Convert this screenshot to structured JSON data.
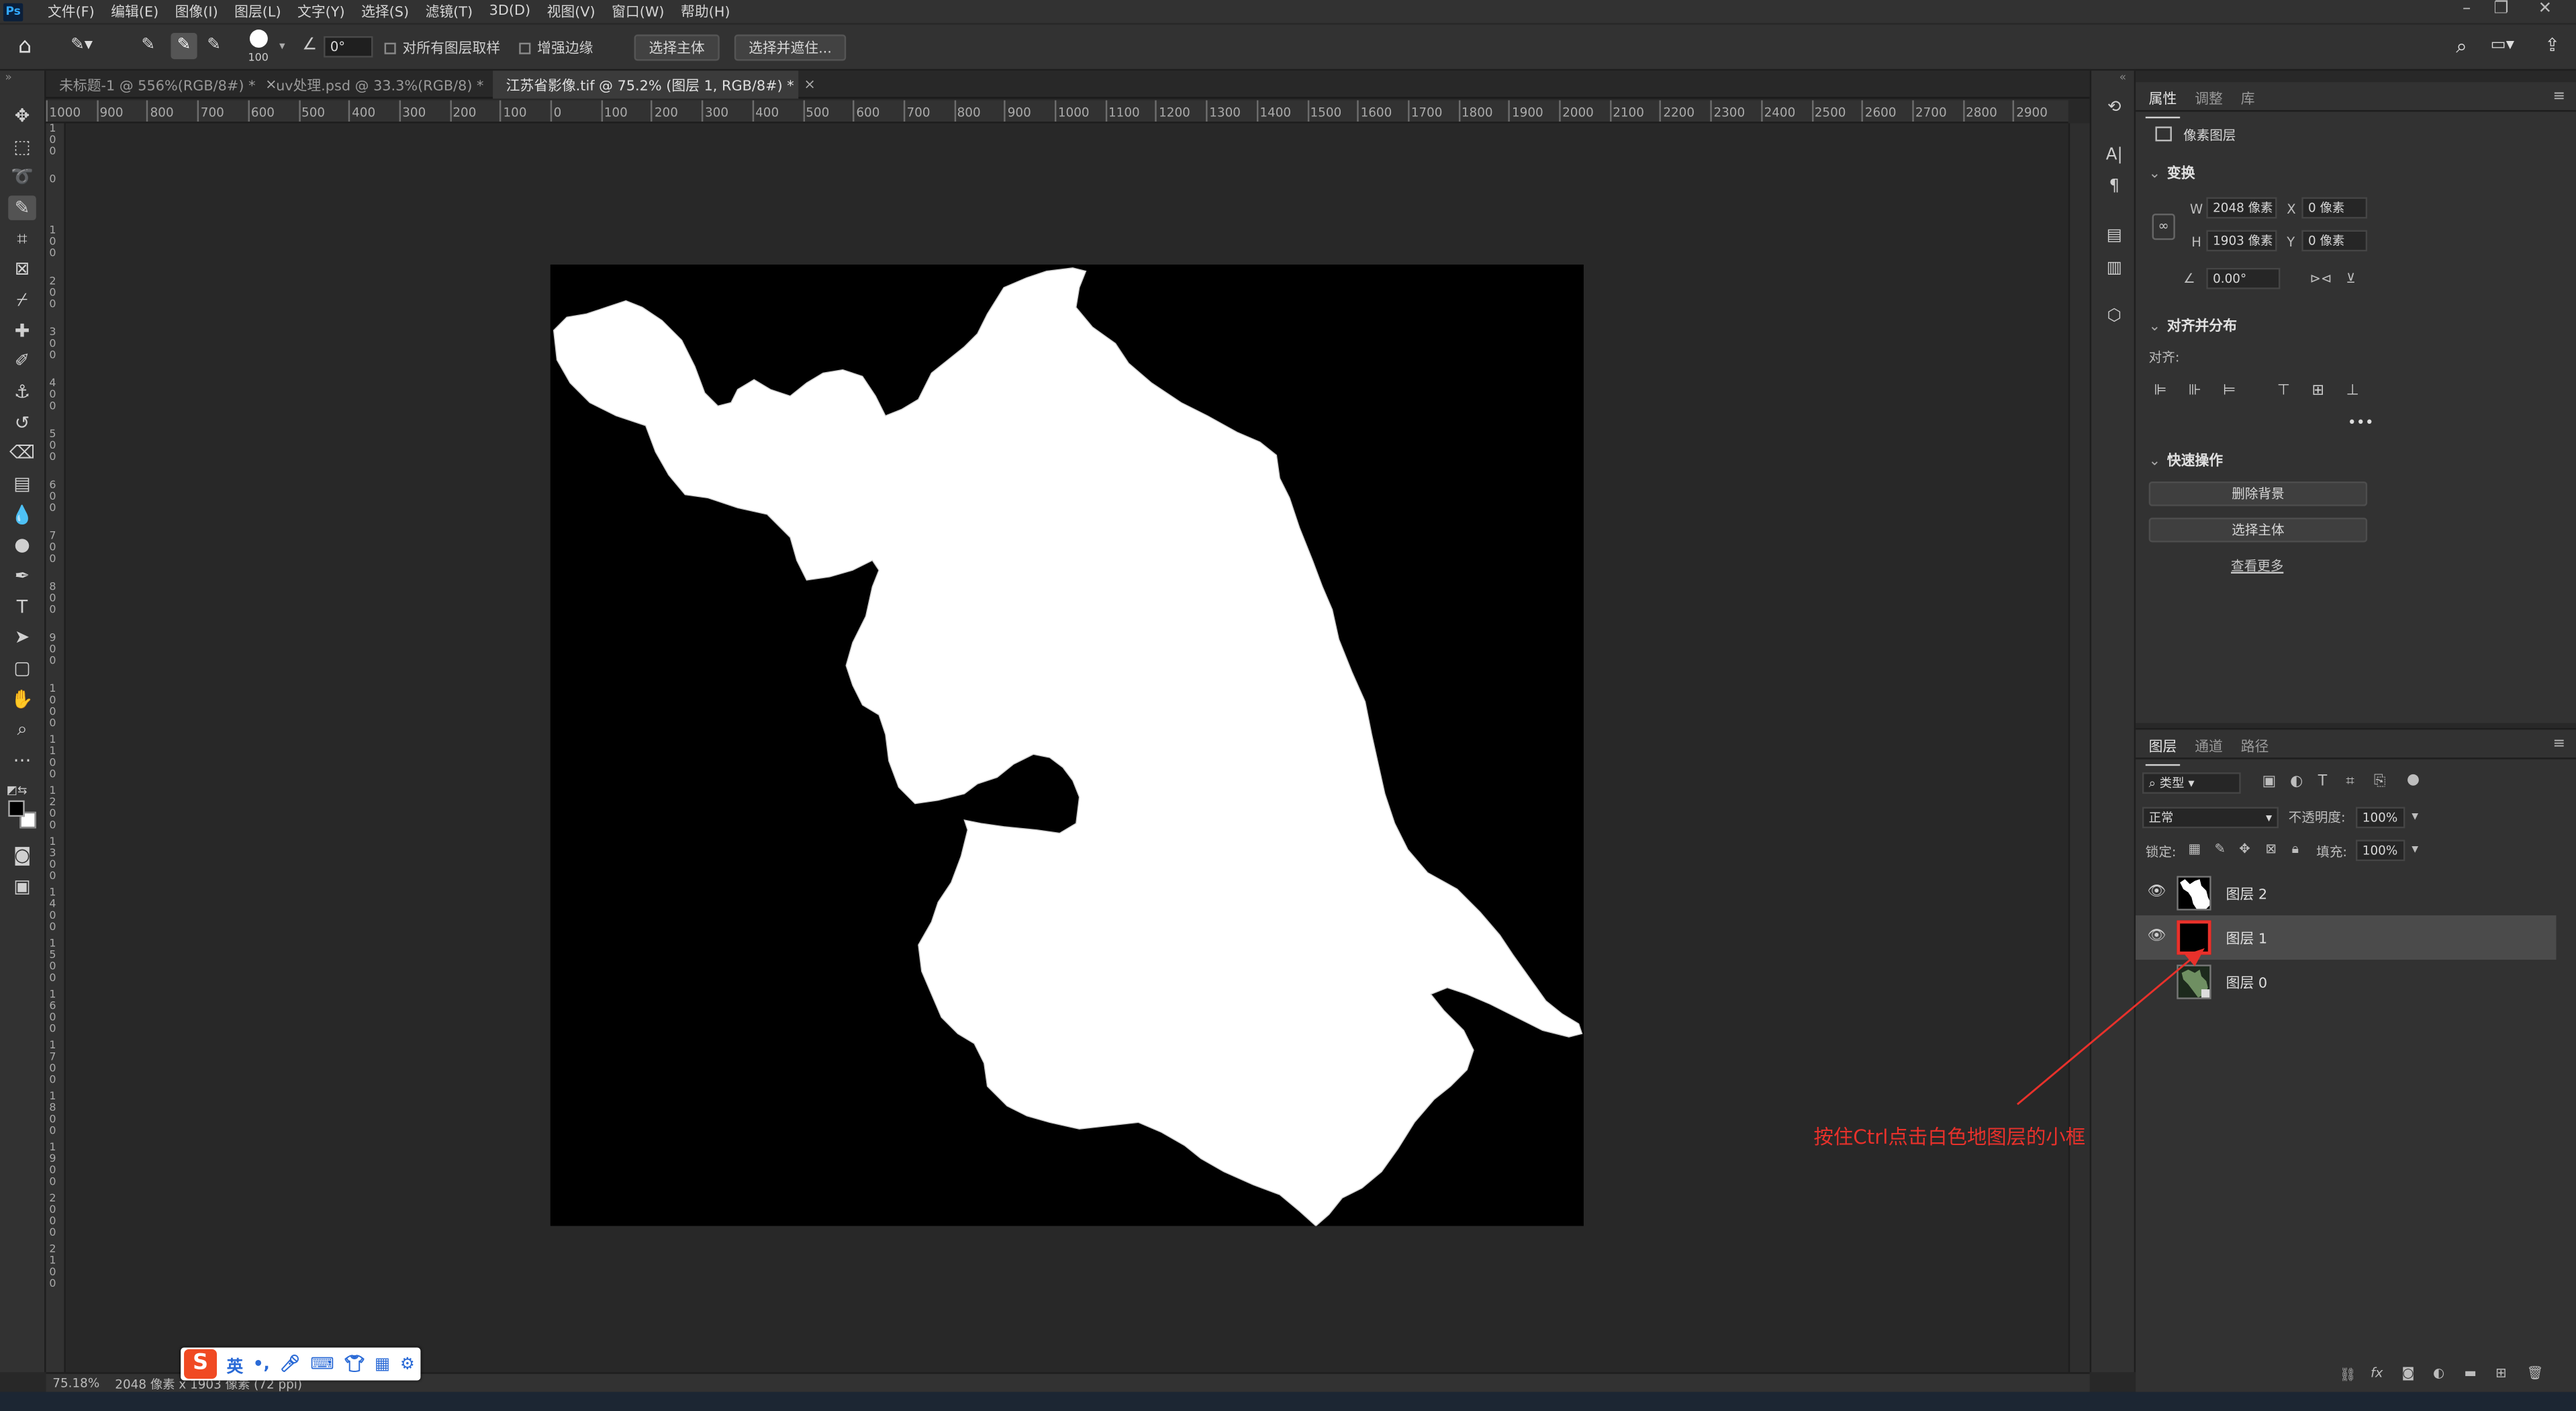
{
  "menu": {
    "logo": "Ps",
    "items": [
      "文件(F)",
      "编辑(E)",
      "图像(I)",
      "图层(L)",
      "文字(Y)",
      "选择(S)",
      "滤镜(T)",
      "3D(D)",
      "视图(V)",
      "窗口(W)",
      "帮助(H)"
    ]
  },
  "options": {
    "brush_size": "100",
    "angle": "0°",
    "sample_all_layers": "对所有图层取样",
    "enhance_edge": "增强边缘",
    "select_subject": "选择主体",
    "select_and_mask": "选择并遮住..."
  },
  "tabs": [
    {
      "label": "未标题-1 @ 556%(RGB/8#) *",
      "active": false
    },
    {
      "label": "uv处理.psd @ 33.3%(RGB/8) *",
      "active": false
    },
    {
      "label": "江苏省影像.tif @ 75.2% (图层 1, RGB/8#) *",
      "active": true
    }
  ],
  "ruler_h": [
    "1000",
    "900",
    "800",
    "700",
    "600",
    "500",
    "400",
    "300",
    "200",
    "100",
    "0",
    "100",
    "200",
    "300",
    "400",
    "500",
    "600",
    "700",
    "800",
    "900",
    "1000",
    "1100",
    "1200",
    "1300",
    "1400",
    "1500",
    "1600",
    "1700",
    "1800",
    "1900",
    "2000",
    "2100",
    "2200",
    "2300",
    "2400",
    "2500",
    "2600",
    "2700",
    "2800",
    "2900"
  ],
  "ruler_v": [
    "100",
    "0",
    "100",
    "200",
    "300",
    "400",
    "500",
    "600",
    "700",
    "800",
    "900",
    "1000",
    "1100",
    "1200",
    "1300",
    "1400",
    "1500",
    "1600",
    "1700",
    "1800",
    "1900",
    "2000",
    "2100"
  ],
  "status": {
    "zoom": "75.18%",
    "doc_size": "2048 像素 x 1903 像素 (72 ppi)"
  },
  "ime": {
    "mode": "英"
  },
  "properties": {
    "tabs": [
      "属性",
      "调整",
      "库"
    ],
    "layer_kind": "像素图层",
    "transform_title": "变换",
    "w_label": "W",
    "w_value": "2048 像素",
    "x_label": "X",
    "x_value": "0 像素",
    "h_label": "H",
    "h_value": "1903 像素",
    "y_label": "Y",
    "y_value": "0 像素",
    "angle_value": "0.00°",
    "align_title": "对齐并分布",
    "align_label": "对齐:",
    "quick_title": "快速操作",
    "remove_bg": "删除背景",
    "select_subject": "选择主体",
    "view_more": "查看更多"
  },
  "layers": {
    "tabs": [
      "图层",
      "通道",
      "路径"
    ],
    "filter_kind": "类型",
    "blend_mode": "正常",
    "opacity_label": "不透明度:",
    "opacity_value": "100%",
    "lock_label": "锁定:",
    "fill_label": "填充:",
    "fill_value": "100%",
    "items": [
      {
        "name": "图层 2",
        "selected": false
      },
      {
        "name": "图层 1",
        "selected": true
      },
      {
        "name": "图层 0",
        "selected": false
      }
    ]
  },
  "annotation": "按住Ctrl点击白色地图层的小框",
  "colors": {
    "accent": "#e8312b",
    "panel": "#323232",
    "canvas": "#282828"
  }
}
